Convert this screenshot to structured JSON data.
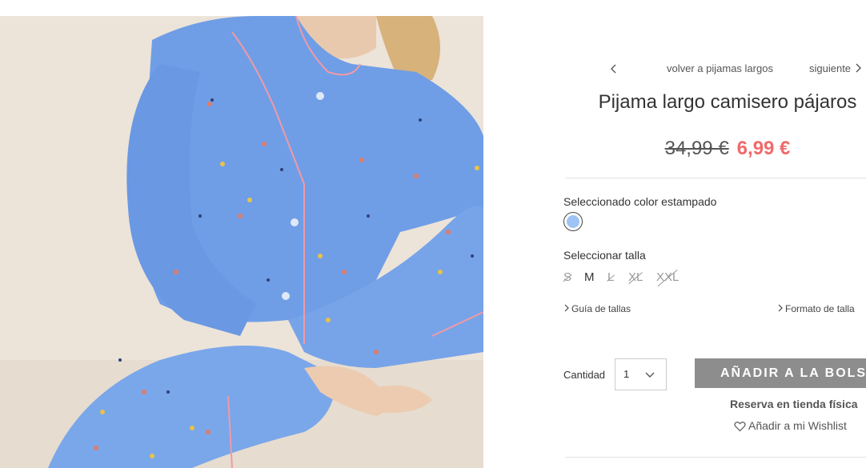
{
  "navigation": {
    "back_label": "volver a pijamas largos",
    "next_label": "siguiente"
  },
  "product": {
    "title": "Pijama largo camisero pájaros",
    "old_price": "34,99 €",
    "new_price": "6,99 €",
    "image_icon": "product-photo"
  },
  "color": {
    "label": "Seleccionado color estampado",
    "swatch_hex": "#9ec3f5"
  },
  "size": {
    "label": "Seleccionar talla",
    "options": [
      {
        "label": "S",
        "available": false
      },
      {
        "label": "M",
        "available": true
      },
      {
        "label": "L",
        "available": false
      },
      {
        "label": "XL",
        "available": false
      },
      {
        "label": "XXL",
        "available": false
      }
    ]
  },
  "links": {
    "size_guide": "Guía de tallas",
    "size_format": "Formato de talla"
  },
  "quantity": {
    "label": "Cantidad",
    "value": "1"
  },
  "actions": {
    "add_to_bag": "AÑADIR A LA BOLSA",
    "reserve_store": "Reserva en tienda física",
    "wishlist": "Añadir a mi Wishlist"
  },
  "colors": {
    "sale_price": "#f06a6a",
    "button_bg": "#8d8d8d",
    "pajama_blue": "#6f9ee6"
  }
}
